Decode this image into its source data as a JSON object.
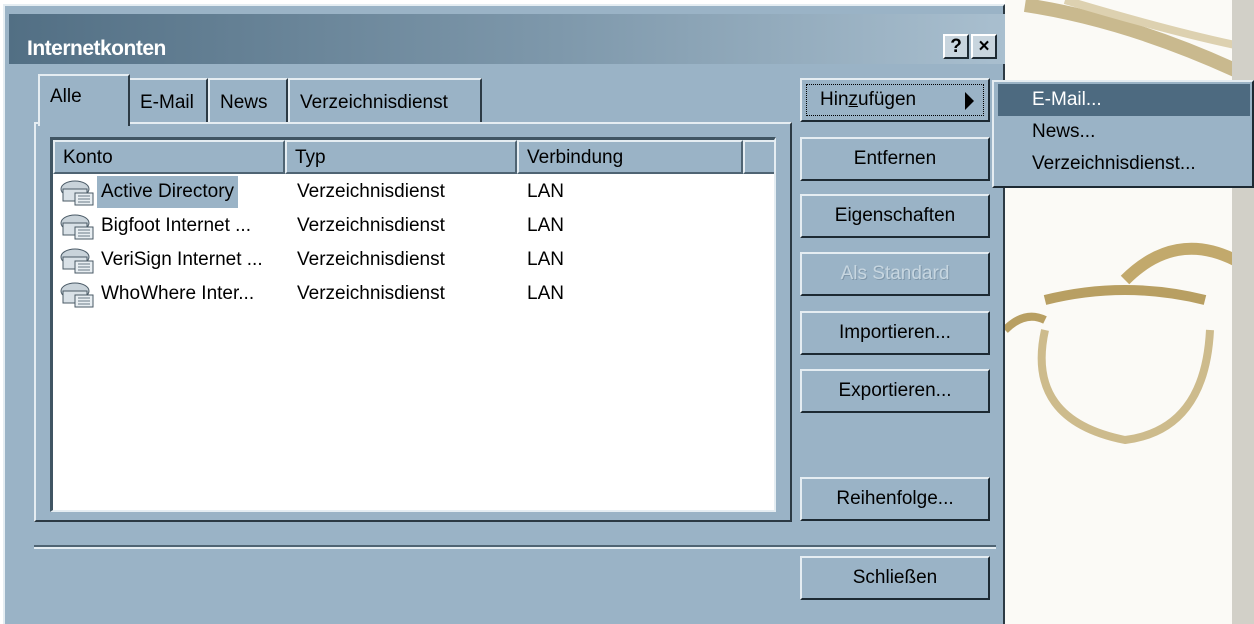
{
  "dialog": {
    "title": "Internetkonten",
    "help_label": "?",
    "close_label": "×"
  },
  "tabs": [
    {
      "label": "Alle",
      "active": true
    },
    {
      "label": "E-Mail"
    },
    {
      "label": "News"
    },
    {
      "label": "Verzeichnisdienst"
    }
  ],
  "list": {
    "columns": [
      "Konto",
      "Typ",
      "Verbindung"
    ],
    "rows": [
      {
        "name": "Active Directory",
        "type": "Verzeichnisdienst",
        "connection": "LAN",
        "selected": true
      },
      {
        "name": "Bigfoot Internet ...",
        "type": "Verzeichnisdienst",
        "connection": "LAN"
      },
      {
        "name": "VeriSign Internet ...",
        "type": "Verzeichnisdienst",
        "connection": "LAN"
      },
      {
        "name": "WhoWhere Inter...",
        "type": "Verzeichnisdienst",
        "connection": "LAN"
      }
    ],
    "row_icon": "directory-service-icon"
  },
  "buttons": {
    "add": "Hinzufügen",
    "add_mnemonic_pre": "Hin",
    "add_mnemonic_char": "z",
    "add_mnemonic_post": "ufügen",
    "remove": "Entfernen",
    "properties": "Eigenschaften",
    "set_default": "Als Standard",
    "import": "Importieren...",
    "export": "Exportieren...",
    "order": "Reihenfolge...",
    "close": "Schließen"
  },
  "add_menu": {
    "items": [
      "E-Mail...",
      "News...",
      "Verzeichnisdienst..."
    ],
    "highlighted_index": 0
  },
  "colors": {
    "dialog_face": "#9ab3c6",
    "highlight": "#4d6a80",
    "title_gradient_start": "#526f84"
  }
}
